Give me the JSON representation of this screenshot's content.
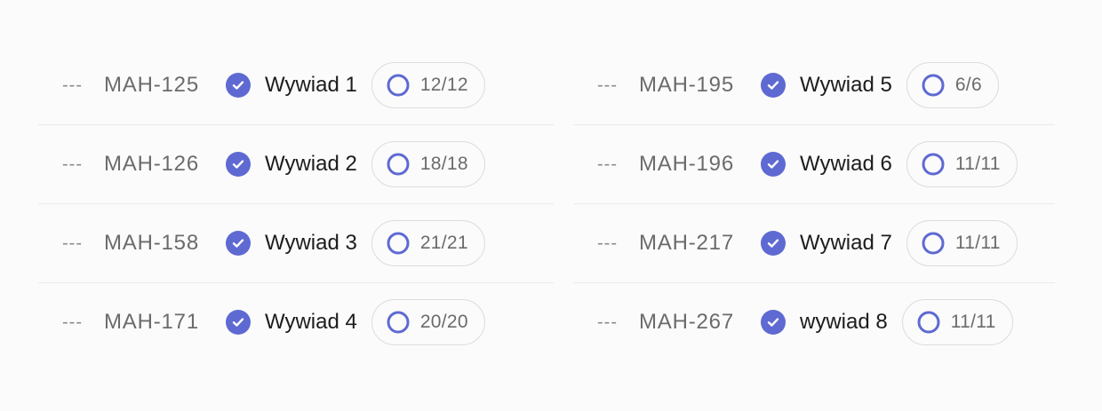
{
  "issues_left": [
    {
      "id": "MAH-125",
      "title": "Wywiad 1",
      "progress": "12/12"
    },
    {
      "id": "MAH-126",
      "title": "Wywiad 2",
      "progress": "18/18"
    },
    {
      "id": "MAH-158",
      "title": "Wywiad 3",
      "progress": "21/21"
    },
    {
      "id": "MAH-171",
      "title": "Wywiad 4",
      "progress": "20/20"
    }
  ],
  "issues_right": [
    {
      "id": "MAH-195",
      "title": "Wywiad 5",
      "progress": "6/6"
    },
    {
      "id": "MAH-196",
      "title": "Wywiad 6",
      "progress": "11/11"
    },
    {
      "id": "MAH-217",
      "title": "Wywiad 7",
      "progress": "11/11"
    },
    {
      "id": "MAH-267",
      "title": "wywiad 8",
      "progress": "11/11"
    }
  ],
  "row_prefix": "---",
  "icons": {
    "status": "check-circle-icon",
    "progress": "progress-ring-icon"
  },
  "colors": {
    "accent": "#5e6ad2",
    "background": "#fbfbfb"
  }
}
